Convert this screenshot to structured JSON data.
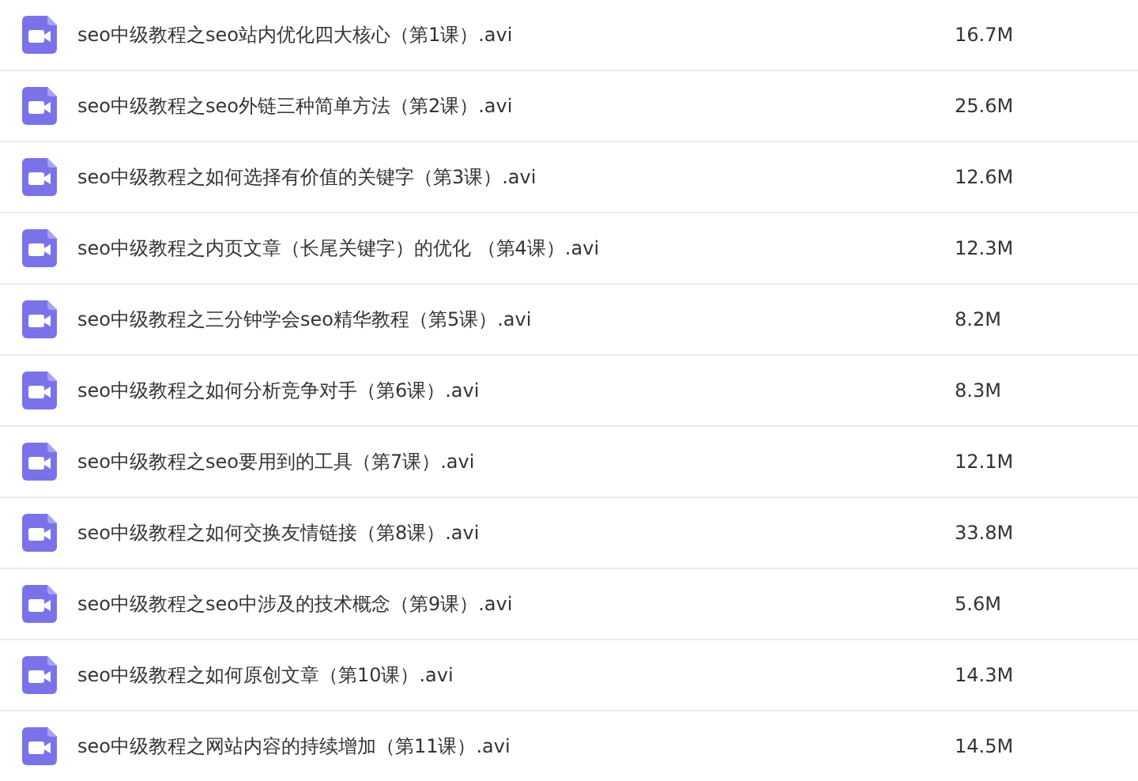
{
  "files": [
    {
      "name": "seo中级教程之seo站内优化四大核心（第1课）.avi",
      "size": "16.7M"
    },
    {
      "name": "seo中级教程之seo外链三种简单方法（第2课）.avi",
      "size": "25.6M"
    },
    {
      "name": "seo中级教程之如何选择有价值的关键字（第3课）.avi",
      "size": "12.6M"
    },
    {
      "name": "seo中级教程之内页文章（长尾关键字）的优化 （第4课）.avi",
      "size": "12.3M"
    },
    {
      "name": "seo中级教程之三分钟学会seo精华教程（第5课）.avi",
      "size": "8.2M"
    },
    {
      "name": "seo中级教程之如何分析竞争对手（第6课）.avi",
      "size": "8.3M"
    },
    {
      "name": "seo中级教程之seo要用到的工具（第7课）.avi",
      "size": "12.1M"
    },
    {
      "name": "seo中级教程之如何交换友情链接（第8课）.avi",
      "size": "33.8M"
    },
    {
      "name": "seo中级教程之seo中涉及的技术概念（第9课）.avi",
      "size": "5.6M"
    },
    {
      "name": "seo中级教程之如何原创文章（第10课）.avi",
      "size": "14.3M"
    },
    {
      "name": "seo中级教程之网站内容的持续增加（第11课）.avi",
      "size": "14.5M"
    }
  ]
}
